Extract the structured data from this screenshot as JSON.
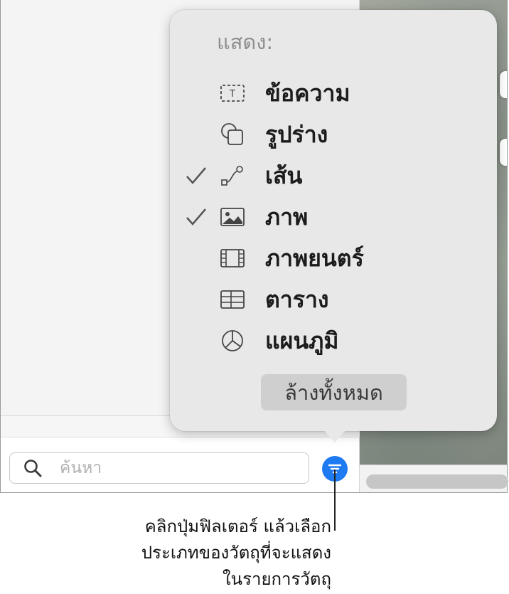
{
  "popover": {
    "header": "แสดง:",
    "items": [
      {
        "label": "ข้อความ",
        "icon": "text-box-icon",
        "checked": false
      },
      {
        "label": "รูปร่าง",
        "icon": "shapes-icon",
        "checked": false
      },
      {
        "label": "เส้น",
        "icon": "line-icon",
        "checked": true
      },
      {
        "label": "ภาพ",
        "icon": "image-icon",
        "checked": true
      },
      {
        "label": "ภาพยนตร์",
        "icon": "film-icon",
        "checked": false
      },
      {
        "label": "ตาราง",
        "icon": "table-icon",
        "checked": false
      },
      {
        "label": "แผนภูมิ",
        "icon": "pie-chart-icon",
        "checked": false
      }
    ],
    "clear_all_label": "ล้างทั้งหมด"
  },
  "search": {
    "placeholder": "ค้นหา"
  },
  "filter_button": {
    "icon": "filter-icon",
    "color": "#1f7bf2"
  },
  "callout": {
    "lines": [
      "คลิกปุ่มฟิลเตอร์ แล้วเลือก",
      "ประเภทของวัตถุที่จะแสดง",
      "ในรายการวัตถุ"
    ]
  }
}
